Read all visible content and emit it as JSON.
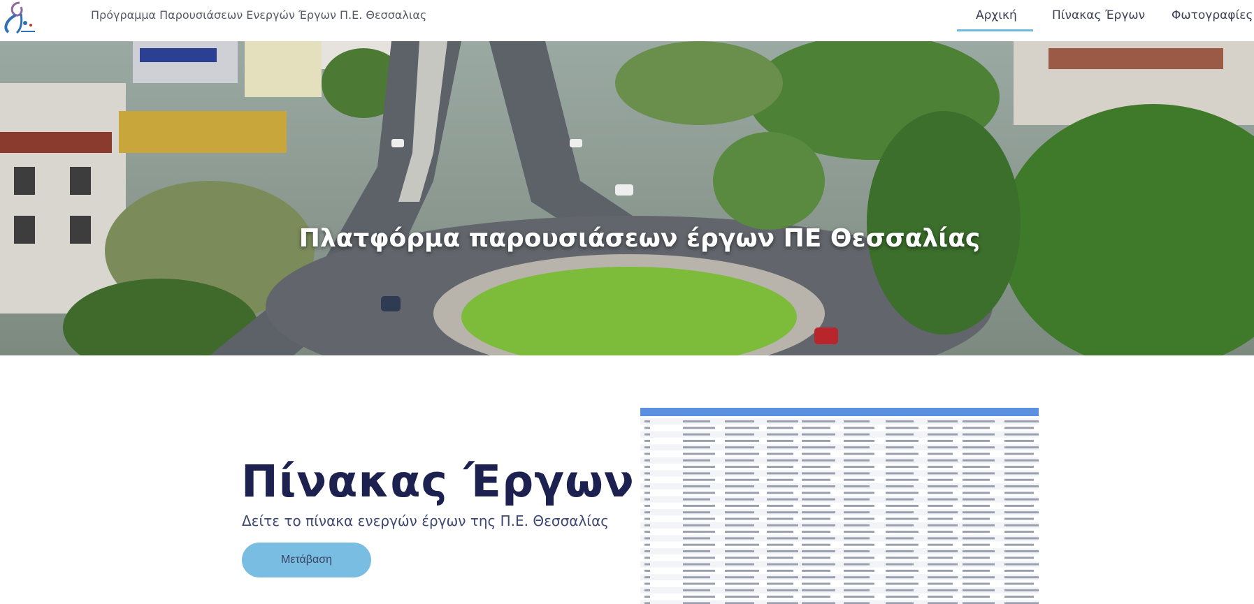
{
  "header": {
    "site_title": "Πρόγραμμα Παρουσιάσεων Ενεργών Έργων Π.Ε. Θεσσαλιας",
    "nav": [
      {
        "label": "Αρχική",
        "active": true
      },
      {
        "label": "Πίνακας Έργων",
        "active": false
      },
      {
        "label": "Φωτογραφίες Έ",
        "active": false
      }
    ]
  },
  "hero": {
    "title": "Πλατφόρμα παρουσιάσεων έργων ΠΕ Θεσσαλίας"
  },
  "section": {
    "title": "Πίνακας Έργων",
    "subtitle": "Δείτε το πίνακα ενεργών έργων της Π.Ε. Θεσσαλίας",
    "button_label": "Μετάβαση"
  },
  "colors": {
    "accent": "#6fb8e0",
    "button_bg": "#79bde3",
    "title_navy": "#1d2150",
    "table_header": "#5b8fe0"
  }
}
